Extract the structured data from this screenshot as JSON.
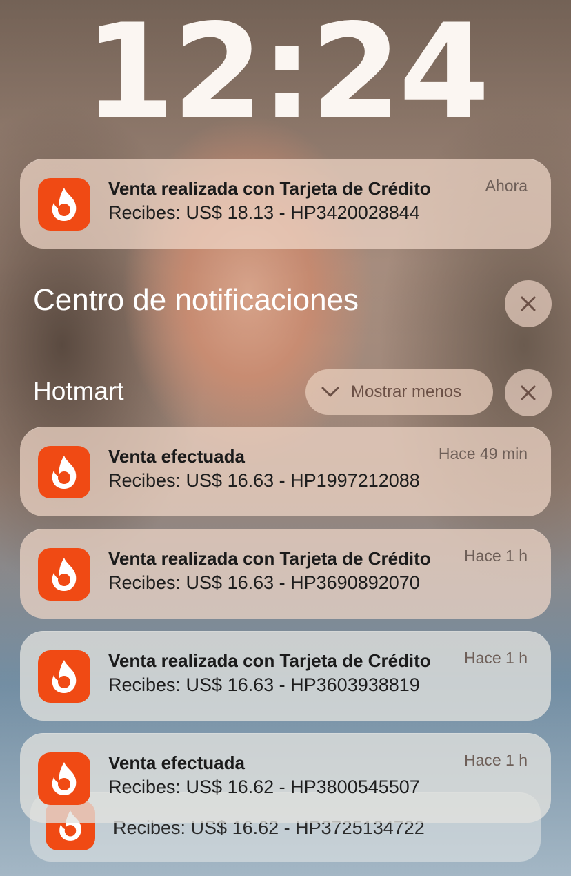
{
  "lock_screen": {
    "time": "12:24"
  },
  "top_notification": {
    "title": "Venta realizada con Tarjeta de Crédito",
    "body": "Recibes: US$ 18.13 - HP3420028844",
    "time": "Ahora",
    "app_icon": "hotmart-flame-icon"
  },
  "notification_center": {
    "title": "Centro de notificaciones"
  },
  "group": {
    "app_name": "Hotmart",
    "show_less_label": "Mostrar menos",
    "notifications": [
      {
        "title": "Venta efectuada",
        "body": "Recibes: US$ 16.63 - HP1997212088",
        "time": "Hace 49 min"
      },
      {
        "title": "Venta realizada con Tarjeta de Crédito",
        "body": "Recibes: US$ 16.63 - HP3690892070",
        "time": "Hace 1 h"
      },
      {
        "title": "Venta realizada con Tarjeta de Crédito",
        "body": "Recibes: US$ 16.63 - HP3603938819",
        "time": "Hace 1 h"
      },
      {
        "title": "Venta efectuada",
        "body": "Recibes: US$ 16.62 - HP3800545507",
        "time": "Hace 1 h"
      },
      {
        "body": "Recibes: US$ 16.62 - HP3725134722"
      }
    ]
  },
  "colors": {
    "app_icon": "#f04a14",
    "text_white": "#ffffff"
  }
}
